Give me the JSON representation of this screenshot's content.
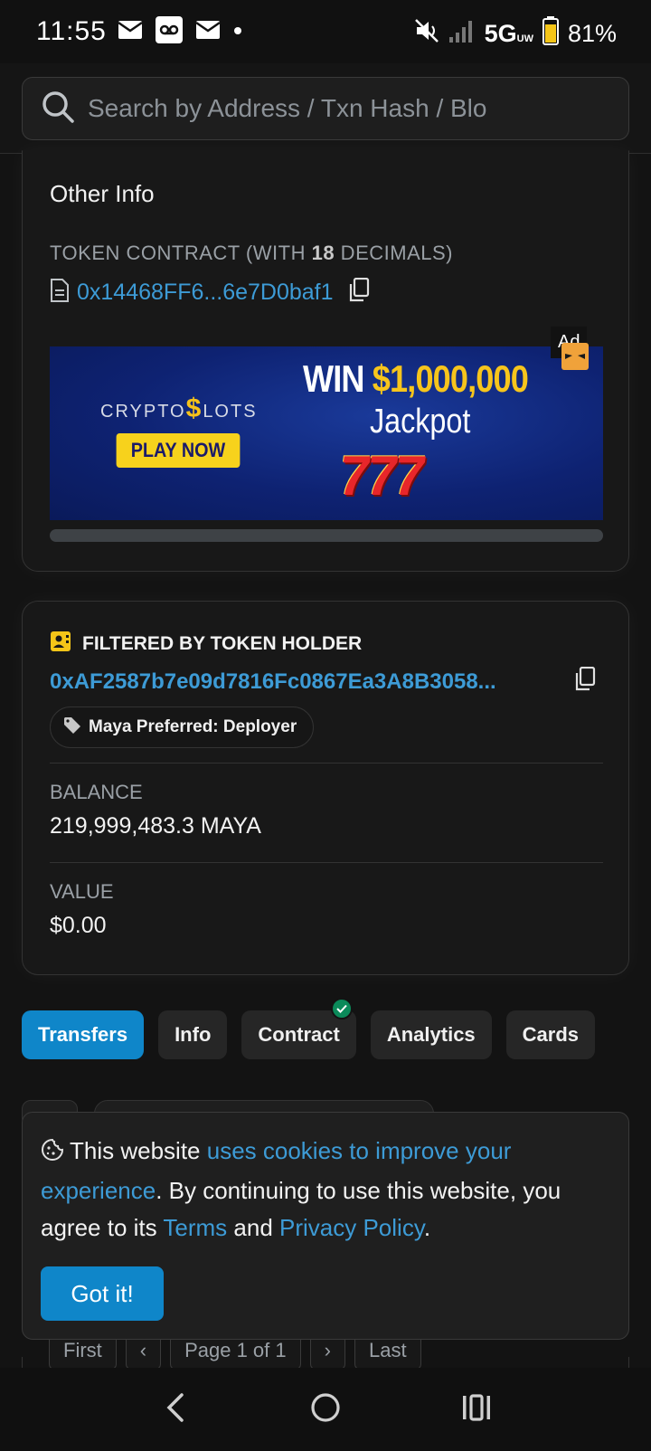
{
  "status_bar": {
    "time": "11:55",
    "network": "5G",
    "network_sub": "UW",
    "battery": "81%"
  },
  "search": {
    "placeholder": "Search by Address / Txn Hash / Blo"
  },
  "other_info": {
    "title": "Other Info",
    "token_contract_label_pre": "TOKEN CONTRACT (WITH ",
    "decimals": "18",
    "token_contract_label_post": " DECIMALS)",
    "token_contract_address": "0x14468FF6...6e7D0baf1"
  },
  "ad": {
    "brand_pre": "CRYPTO",
    "brand_dollar": "$",
    "brand_post": "LOTS",
    "cta": "PLAY NOW",
    "win": "WIN ",
    "amount": "$1,000,000",
    "jackpot": "Jackpot",
    "sevens": "777",
    "badge": "Ad"
  },
  "holder": {
    "title": "FILTERED BY TOKEN HOLDER",
    "address": "0xAF2587b7e09d7816Fc0867Ea3A8B3058...",
    "tag": "Maya Preferred: Deployer",
    "balance_label": "BALANCE",
    "balance_value": "219,999,483.3 MAYA",
    "value_label": "VALUE",
    "value_value": "$0.00"
  },
  "tabs": [
    {
      "label": "Transfers",
      "active": true
    },
    {
      "label": "Info",
      "active": false
    },
    {
      "label": "Contract",
      "active": false,
      "verified": true
    },
    {
      "label": "Analytics",
      "active": false
    },
    {
      "label": "Cards",
      "active": false
    }
  ],
  "cookie": {
    "text_1": "This website ",
    "link_1": "uses cookies to improve your experience",
    "text_2": ". By continuing to use this website, you agree to its ",
    "link_2": "Terms",
    "text_3": " and ",
    "link_3": "Privacy Policy",
    "text_4": ".",
    "button": "Got it!"
  },
  "pager": {
    "first": "First",
    "prev": "‹",
    "page": "Page 1 of 1",
    "next": "›",
    "last": "Last"
  },
  "colors": {
    "accent": "#0f86c9",
    "link": "#3d9bd6",
    "background": "#131313"
  }
}
